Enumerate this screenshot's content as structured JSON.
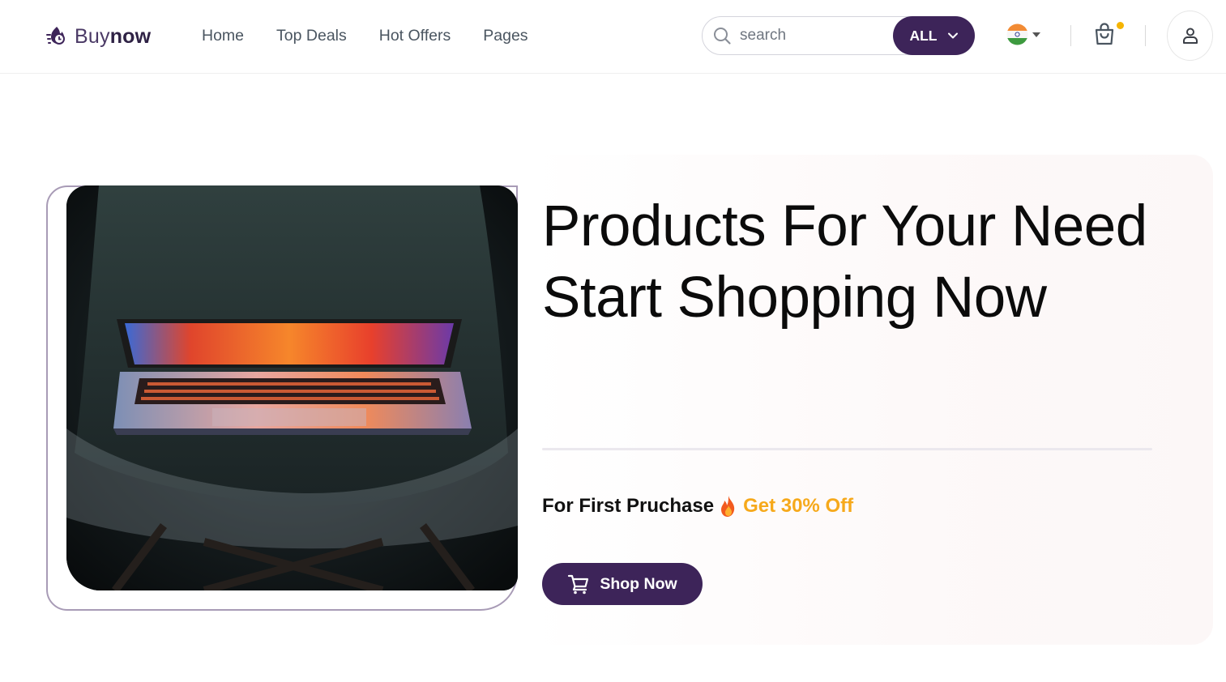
{
  "header": {
    "logo": {
      "prefix": "Buy",
      "suffix": "now",
      "icon": "fire-clock-icon"
    },
    "nav": [
      {
        "label": "Home"
      },
      {
        "label": "Top Deals"
      },
      {
        "label": "Hot Offers"
      },
      {
        "label": "Pages"
      }
    ],
    "search": {
      "placeholder": "search",
      "value": "",
      "category": "ALL",
      "icon": "search-icon"
    },
    "language": {
      "icon": "india-flag-icon"
    },
    "cart": {
      "icon": "shopping-bag-icon",
      "has_notification": true
    },
    "account": {
      "icon": "user-icon"
    }
  },
  "hero": {
    "headline": "Products For Your Need Start Shopping Now",
    "offer": {
      "prefix": "For First Pruchase",
      "icon": "fire-icon",
      "accent": "Get 30% Off"
    },
    "cta": {
      "label": "Shop Now",
      "icon": "cart-icon"
    },
    "image": {
      "icon": "laptop-image"
    }
  },
  "colors": {
    "brand": "#3d2459",
    "accent": "#f6a91b",
    "notification": "#f5b400"
  }
}
